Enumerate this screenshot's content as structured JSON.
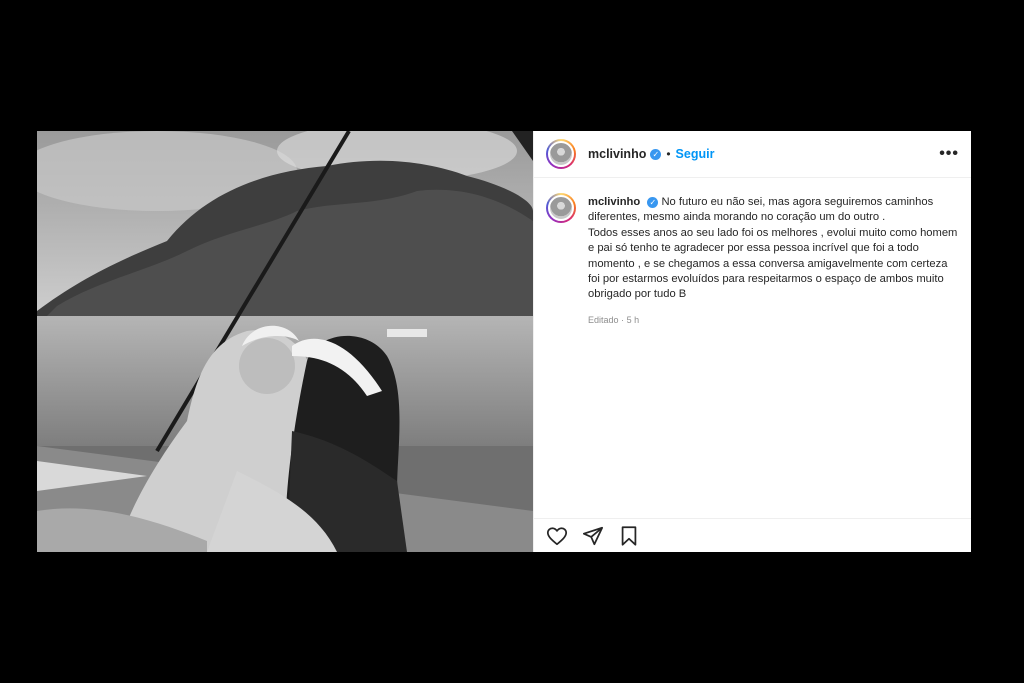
{
  "post": {
    "username": "mclivinho",
    "verified_icon": "verified-badge-icon",
    "separator": "•",
    "follow_label": "Seguir",
    "more_label": "•••",
    "caption_username": "mclivinho",
    "caption": "No futuro eu não sei, mas agora seguiremos caminhos diferentes, mesmo ainda morando no coração um do outro .\nTodos esses anos ao seu lado foi os melhores , evolui muito como homem e pai só tenho te agradecer por essa pessoa incrível que foi a todo momento , e se chegamos a essa conversa amigavelmente com certeza foi por estarmos evoluídos para respeitarmos o espaço de ambos muito obrigado por tudo B",
    "edited_label": "Editado",
    "time_separator": "·",
    "time_ago": "5 h"
  },
  "icons": {
    "like": "heart-icon",
    "share": "send-icon",
    "save": "bookmark-icon",
    "more": "more-options-icon"
  },
  "colors": {
    "background": "#000000",
    "follow_blue": "#0095f6",
    "verified_blue": "#3897f0",
    "text": "#262626",
    "muted": "#8e8e8e"
  }
}
